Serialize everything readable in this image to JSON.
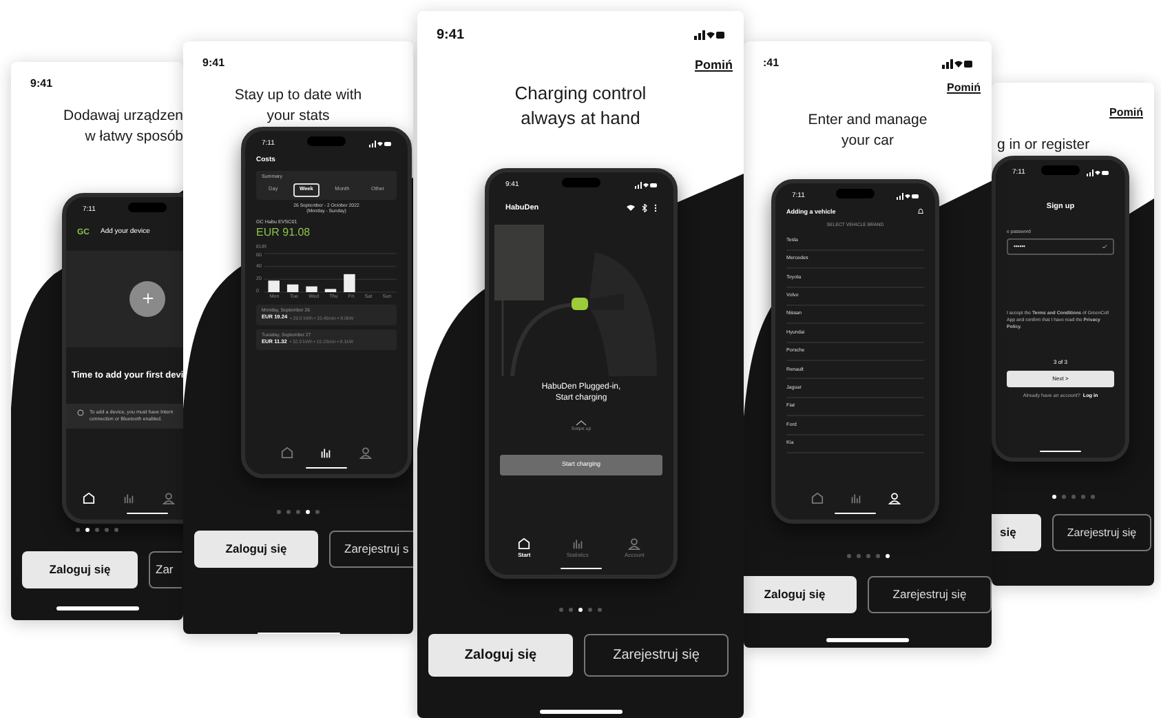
{
  "cards": [
    {
      "time": "9:41",
      "title": [
        "Dodawaj urządzen",
        "w łatwy sposób"
      ],
      "phone": {
        "kind": "device",
        "time": "7:11",
        "logo": "GC",
        "header": "Add your device",
        "heading": "Time to add your first devi",
        "info": [
          "To add a device, you must have Intern",
          "connection or Bluetooth enabled."
        ],
        "nav": [
          {
            "kind": "home",
            "selected": true
          },
          {
            "kind": "stats",
            "selected": false
          },
          {
            "kind": "account",
            "selected": false
          }
        ]
      },
      "dots": [
        {
          "selected": false
        },
        {
          "selected": true
        },
        {
          "selected": false
        },
        {
          "selected": false
        },
        {
          "selected": false
        }
      ],
      "login": "Zaloguj się",
      "register": "Zar"
    },
    {
      "time": "9:41",
      "title": [
        "Stay up to date with",
        "your stats"
      ],
      "phone": {
        "kind": "stats",
        "time": "7:11",
        "header": "Costs",
        "summary": "Summary",
        "segments": [
          {
            "label": "Day",
            "selected": false
          },
          {
            "label": "Week",
            "selected": true
          },
          {
            "label": "Month",
            "selected": false
          },
          {
            "label": "Other",
            "selected": false
          }
        ],
        "range": [
          "26 September - 2 October 2022",
          "(Monday - Sunday)"
        ],
        "device": "GC Habu EVSC01",
        "total": "EUR 91.08",
        "chart_data": {
          "type": "bar",
          "ylabel": "EUR",
          "categories": [
            "Mon",
            "Tue",
            "Wed",
            "Thu",
            "Fri",
            "Sat",
            "Sun"
          ],
          "values": [
            18,
            12,
            9,
            5,
            28,
            0,
            0
          ],
          "ylim": [
            0,
            60
          ],
          "yticks": [
            0,
            20,
            40,
            60
          ]
        },
        "entries": [
          {
            "date": "Monday, September 26",
            "amount": "EUR 19.24",
            "detail": "• 29.0 kWh • 15:46min • 8.0kW"
          },
          {
            "date": "Tuesday, September 27",
            "amount": "EUR 11.32",
            "detail": "• 32.0 kWh • 15:23min • 8.1kW"
          }
        ],
        "nav": [
          {
            "kind": "home",
            "selected": false
          },
          {
            "kind": "stats",
            "selected": true
          },
          {
            "kind": "account",
            "selected": false
          }
        ]
      },
      "dots": [
        {
          "selected": false
        },
        {
          "selected": false
        },
        {
          "selected": false
        },
        {
          "selected": true
        },
        {
          "selected": false
        }
      ],
      "login": "Zaloguj się",
      "register": "Zarejestruj s"
    },
    {
      "time": "9:41",
      "skip": "Pomiń",
      "title": [
        "Charging control",
        "always at hand"
      ],
      "phone": {
        "kind": "charging",
        "time": "9:41",
        "header": "HabuDen",
        "message": [
          "HabuDen Plugged-in,",
          "Start charging"
        ],
        "swipe": "Swipe up",
        "action": "Start charging",
        "nav": [
          {
            "kind": "home",
            "label": "Start",
            "selected": true
          },
          {
            "kind": "stats",
            "label": "Statistics",
            "selected": false
          },
          {
            "kind": "account",
            "label": "Account",
            "selected": false
          }
        ]
      },
      "dots": [
        {
          "selected": false
        },
        {
          "selected": false
        },
        {
          "selected": true
        },
        {
          "selected": false
        },
        {
          "selected": false
        }
      ],
      "login": "Zaloguj się",
      "register": "Zarejestruj się"
    },
    {
      "time": ":41",
      "skip": "Pomiń",
      "title": [
        "Enter and manage",
        "your car"
      ],
      "phone": {
        "kind": "vehicle",
        "time": "7:11",
        "header": "Adding a vehicle",
        "section": "SELECT VEHICLE BRAND",
        "brands": [
          "Tesla",
          "Mercedes",
          "Toyota",
          "Volvo",
          "Nissan",
          "Hyundai",
          "Porsche",
          "Renault",
          "Jaguar",
          "Fiat",
          "Ford",
          "Kia"
        ],
        "nav": [
          {
            "kind": "home",
            "selected": false
          },
          {
            "kind": "stats",
            "selected": false
          },
          {
            "kind": "account",
            "selected": true
          }
        ]
      },
      "dots": [
        {
          "selected": false
        },
        {
          "selected": false
        },
        {
          "selected": false
        },
        {
          "selected": false
        },
        {
          "selected": true
        }
      ],
      "login": "Zaloguj się",
      "register": "Zarejestruj się"
    },
    {
      "skip": "Pomiń",
      "title": [
        "g in or register"
      ],
      "phone": {
        "kind": "signup",
        "time": "7:11",
        "header": "Sign up",
        "field_label": "e password",
        "field_value": "••••••",
        "terms": "I accept the **Terms and Conditions** of GreenCell App and confirm that I have read the **Privacy Policy**.",
        "step": "3 of 3",
        "next": "Next >",
        "account_prompt": "Already have an account?",
        "login_link": "Log in"
      },
      "dots": [
        {
          "selected": true
        },
        {
          "selected": false
        },
        {
          "selected": false
        },
        {
          "selected": false
        },
        {
          "selected": false
        }
      ],
      "login": "się",
      "register": "Zarejestruj się"
    }
  ]
}
